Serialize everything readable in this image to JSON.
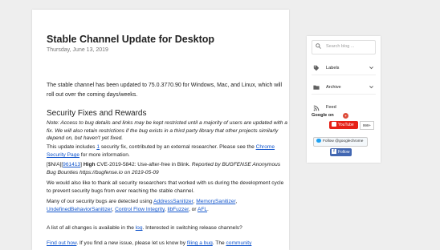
{
  "post": {
    "title": "Stable Channel Update for Desktop",
    "date": "Thursday, June 13, 2019",
    "intro_1": "The stable channel has been updated to 75.0.3770.90 for Windows, Mac, and Linux, which will roll out over the coming days/weeks.",
    "heading": "Security Fixes and Rewards",
    "note": "Note: Access to bug details and links may be kept restricted until a majority of users are updated with a fix. We will also retain restrictions if the bug exists in a third party library that other projects similarly depend on, but haven't yet fixed.",
    "fix_pre": "This update includes ",
    "fix_count": "1",
    "fix_mid": " security fix, contributed by an external researcher. Please see the ",
    "fix_link": "Chrome Security Page",
    "fix_post": " for more information.",
    "bug_prefix": "[$N/A][",
    "bug_id": "961413",
    "bug_suffix": "] ",
    "bug_sev": "High",
    "bug_desc": " CVE-2019-5842: Use-after-free in Blink. ",
    "bug_credit": "Reported by BUGFENSE Anonymous Bug Bounties https://bugfense.io on 2019-05-09",
    "thanks": "We would also like to thank all security researchers that worked with us during the development cycle to prevent security bugs from ever reaching the stable channel.",
    "detected_pre": "Many of our security bugs are detected using ",
    "tools": [
      "AddressSanitizer",
      "MemorySanitizer",
      "UndefinedBehaviorSanitizer",
      "Control Flow Integrity",
      "libFuzzer"
    ],
    "sep": ", ",
    "or": ", or ",
    "afl": "AFL",
    "period": ".",
    "changes_pre": "A list of all changes is available in the ",
    "log_link": "log",
    "changes_post": ". Interested in switching release channels?",
    "findout_link": "Find out how",
    "findout_mid": ". If you find a new issue, please let us know by ",
    "filing_link": "filing a bug",
    "findout_post": ". The ",
    "community_link": "community"
  },
  "sidebar": {
    "search_placeholder": "Search blog ...",
    "labels": "Labels",
    "archive": "Archive",
    "feed": "Feed",
    "google_on": "Google on",
    "youtube": "YouTube",
    "youtube_count": "999+",
    "twitter": "Follow @googlechrome",
    "facebook": "Follow"
  }
}
